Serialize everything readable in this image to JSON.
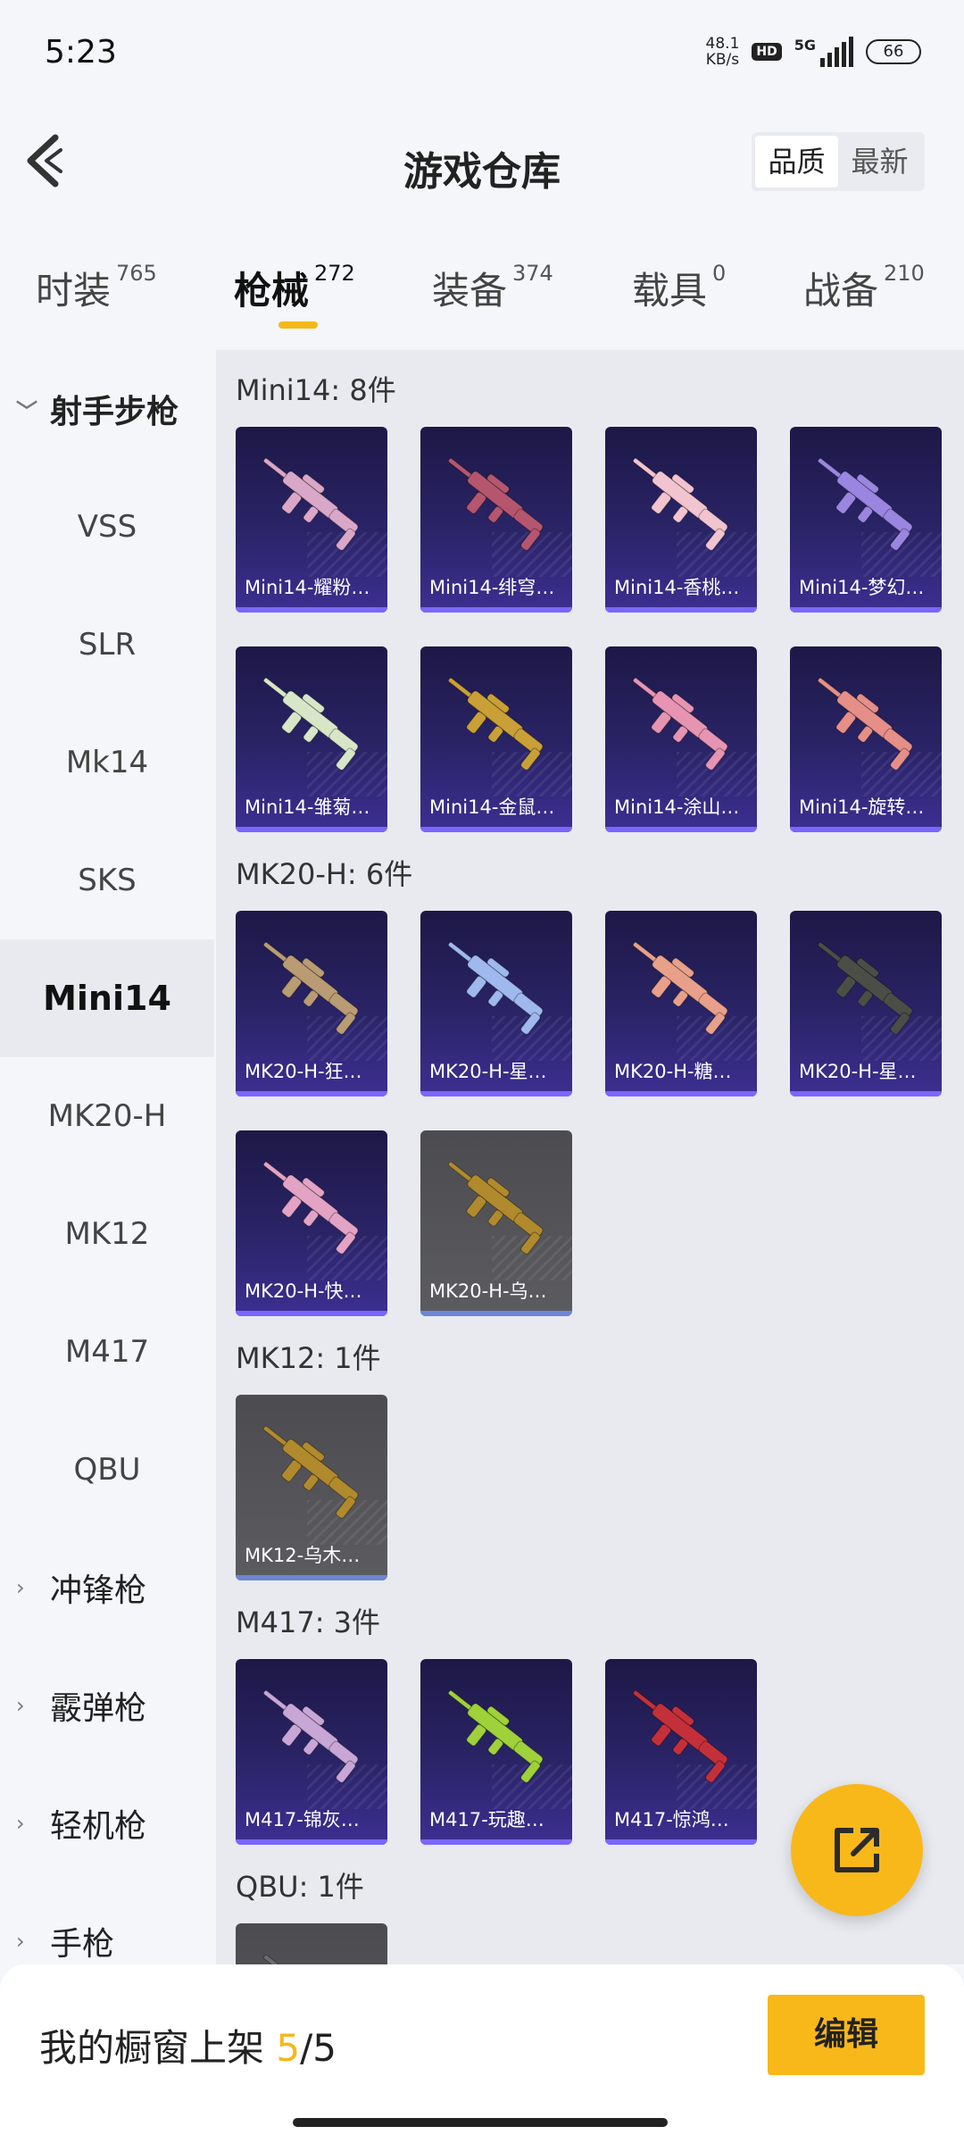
{
  "status_bar": {
    "time": "5:23",
    "net_speed_value": "48.1",
    "net_speed_unit": "KB/s",
    "hd": "HD",
    "network": "5G",
    "battery": "66"
  },
  "header": {
    "title": "游戏仓库",
    "sort_options": [
      "品质",
      "最新"
    ],
    "active_sort": "品质"
  },
  "tabs": [
    {
      "label": "时装",
      "count": "765"
    },
    {
      "label": "枪械",
      "count": "272",
      "active": true
    },
    {
      "label": "装备",
      "count": "374"
    },
    {
      "label": "载具",
      "count": "0"
    },
    {
      "label": "战备",
      "count": "210"
    }
  ],
  "sidebar": {
    "open_group": "射手步枪",
    "items": [
      "VSS",
      "SLR",
      "Mk14",
      "SKS",
      "Mini14",
      "MK20-H",
      "MK12",
      "M417",
      "QBU"
    ],
    "active_item": "Mini14",
    "collapsed_groups": [
      "冲锋枪",
      "霰弹枪",
      "轻机枪",
      "手枪"
    ]
  },
  "sections": [
    {
      "title": "Mini14: 8件",
      "items": [
        {
          "label": "Mini14-耀粉…",
          "skin": "pink",
          "color": "#d9a7c7"
        },
        {
          "label": "Mini14-绯穹…",
          "skin": "crimson",
          "color": "#b5566e"
        },
        {
          "label": "Mini14-香桃…",
          "skin": "peach",
          "color": "#f1c4cf"
        },
        {
          "label": "Mini14-梦幻…",
          "skin": "violet",
          "color": "#9a86e0"
        },
        {
          "label": "Mini14-雏菊…",
          "skin": "mint",
          "color": "#d8e6c8"
        },
        {
          "label": "Mini14-金鼠…",
          "skin": "gold",
          "color": "#c9a036"
        },
        {
          "label": "Mini14-涂山…",
          "skin": "rose",
          "color": "#e694b2"
        },
        {
          "label": "Mini14-旋转…",
          "skin": "coral",
          "color": "#e58f88"
        }
      ]
    },
    {
      "title": "MK20-H: 6件",
      "items": [
        {
          "label": "MK20-H-狂…",
          "skin": "bronze",
          "color": "#b99b74"
        },
        {
          "label": "MK20-H-星…",
          "skin": "ice",
          "color": "#9fb8ee"
        },
        {
          "label": "MK20-H-糖…",
          "skin": "salmon",
          "color": "#e8a08a"
        },
        {
          "label": "MK20-H-星…",
          "skin": "dark",
          "color": "#4b4d47"
        },
        {
          "label": "MK20-H-快…",
          "skin": "pink",
          "color": "#e3a3c4"
        },
        {
          "label": "MK20-H-乌…",
          "skin": "blackgold",
          "color": "#b08a2c",
          "grey": true
        }
      ]
    },
    {
      "title": "MK12: 1件",
      "items": [
        {
          "label": "MK12-乌木…",
          "skin": "blackgold",
          "color": "#b08a2c",
          "grey": true
        }
      ]
    },
    {
      "title": "M417: 3件",
      "items": [
        {
          "label": "M417-锦灰…",
          "skin": "lilac",
          "color": "#c8a6d6"
        },
        {
          "label": "M417-玩趣…",
          "skin": "lime",
          "color": "#9ed13a"
        },
        {
          "label": "M417-惊鸿…",
          "skin": "red",
          "color": "#c4303a"
        }
      ]
    },
    {
      "title": "QBU: 1件",
      "items": [
        {
          "label": "",
          "skin": "grey",
          "color": "#6c6c70",
          "grey": true
        }
      ]
    }
  ],
  "bottom_bar": {
    "label": "我的橱窗上架",
    "current": "5",
    "total": "/5",
    "edit_label": "编辑"
  },
  "colors": {
    "accent": "#f8b81a",
    "card_bg": "#2a2467",
    "card_bar": "#7a66ff"
  },
  "icons": {
    "back": "chevron-left-icon",
    "fab": "external-share-icon"
  }
}
